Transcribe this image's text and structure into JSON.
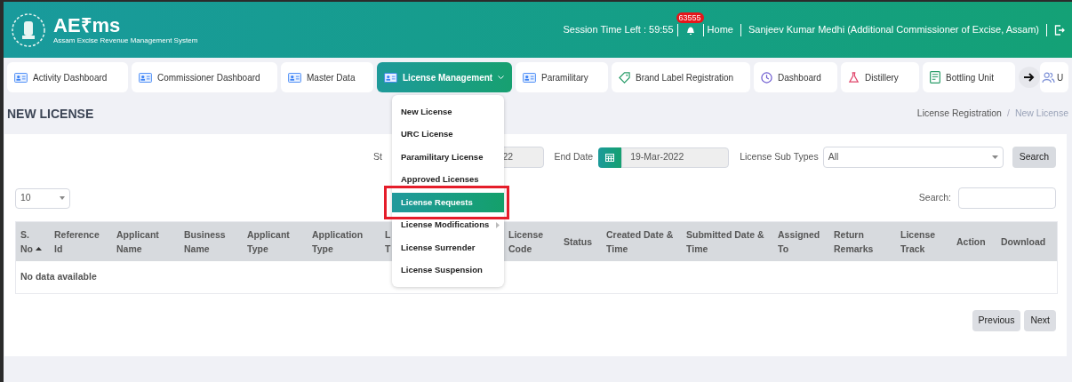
{
  "header": {
    "logo_text": "AE₹ms",
    "logo_subtitle": "Assam Excise Revenue Management System",
    "session": "Session Time Left : 59:55",
    "notification_count": "63555",
    "home_link": "Home",
    "user": "Sanjeev Kumar Medhi (Additional Commissioner of Excise, Assam)"
  },
  "nav_tabs": [
    {
      "label": "Activity Dashboard",
      "kind": "card",
      "selected": false
    },
    {
      "label": "Commissioner Dashboard",
      "kind": "card",
      "selected": false
    },
    {
      "label": "Master Data",
      "kind": "card",
      "selected": false
    },
    {
      "label": "License Management",
      "kind": "card",
      "selected": true,
      "has_menu": true
    },
    {
      "label": "Paramilitary",
      "kind": "card",
      "selected": false
    },
    {
      "label": "Brand Label Registration",
      "kind": "tag",
      "selected": false
    },
    {
      "label": "Dashboard",
      "kind": "clock",
      "selected": false
    },
    {
      "label": "Distillery",
      "kind": "flask",
      "selected": false
    },
    {
      "label": "Bottling Unit",
      "kind": "document",
      "selected": false
    },
    {
      "label": "U",
      "kind": "users",
      "selected": false
    }
  ],
  "dropdown": [
    {
      "label": "New License",
      "selected": false
    },
    {
      "label": "URC License",
      "selected": false
    },
    {
      "label": "Paramilitary License",
      "selected": false
    },
    {
      "label": "Approved Licenses",
      "selected": false
    },
    {
      "label": "License Requests",
      "selected": true,
      "outlined": true
    },
    {
      "label": "License Modifications",
      "selected": false,
      "has_submenu": true
    },
    {
      "label": "License Surrender",
      "selected": false
    },
    {
      "label": "License Suspension",
      "selected": false
    }
  ],
  "page_title": "NEW LICENSE",
  "breadcrumb": [
    "License Registration",
    "New License"
  ],
  "breadcrumb_separator": "/",
  "filters": {
    "start_label": "St",
    "start_value": "22",
    "end_label": "End Date",
    "end_value": "19-Mar-2022",
    "subtype_label": "License Sub Types",
    "subtype_value": "All",
    "search_button": "Search"
  },
  "page_length": "10",
  "search_label": "Search:",
  "table": {
    "columns": [
      {
        "lines": [
          "S.",
          "No"
        ],
        "sorted_ascending": true
      },
      {
        "lines": [
          "Reference",
          "Id"
        ]
      },
      {
        "lines": [
          "Applicant",
          "Name"
        ]
      },
      {
        "lines": [
          "Business",
          "Name"
        ]
      },
      {
        "lines": [
          "Applicant",
          "Type"
        ]
      },
      {
        "lines": [
          "Application",
          "Type"
        ]
      },
      {
        "lines": [
          "L",
          "T"
        ]
      },
      {
        "lines": [
          "License",
          "Code"
        ]
      },
      {
        "lines": [
          "Status"
        ]
      },
      {
        "lines": [
          "Created Date &",
          "Time"
        ]
      },
      {
        "lines": [
          "Submitted Date &",
          "Time"
        ]
      },
      {
        "lines": [
          "Assigned",
          "To"
        ]
      },
      {
        "lines": [
          "Return",
          "Remarks"
        ]
      },
      {
        "lines": [
          "License",
          "Track"
        ]
      },
      {
        "lines": [
          "Action"
        ]
      },
      {
        "lines": [
          "Download"
        ]
      }
    ],
    "empty_message": "No data available"
  },
  "pagination": [
    "Previous",
    "Next"
  ]
}
